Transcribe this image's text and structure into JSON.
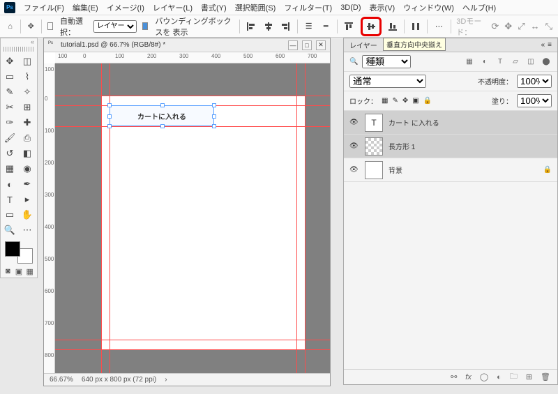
{
  "menu": {
    "file": "ファイル(F)",
    "edit": "編集(E)",
    "image": "イメージ(I)",
    "layer": "レイヤー(L)",
    "type": "書式(Y)",
    "select": "選択範囲(S)",
    "filter": "フィルター(T)",
    "3d": "3D(D)",
    "view": "表示(V)",
    "window": "ウィンドウ(W)",
    "help": "ヘルプ(H)"
  },
  "options": {
    "auto_select_label": "自動選択：",
    "auto_select_target": "レイヤー",
    "show_bbox": "バウンディングボックスを 表示",
    "mode3d": "3Dモード："
  },
  "tooltip": "垂直方向中央揃え",
  "document": {
    "title": "tutorial1.psd @ 66.7% (RGB/8#) *",
    "zoom": "66.67%",
    "dims": "640 px x 800 px (72 ppi)",
    "ruler_h": [
      "100",
      "0",
      "100",
      "200",
      "300",
      "400",
      "500",
      "600",
      "700"
    ],
    "ruler_v": [
      "100",
      "0",
      "100",
      "200",
      "300",
      "400",
      "500",
      "600",
      "700",
      "800"
    ],
    "selected_text": "カートに入れる"
  },
  "layers_panel": {
    "title": "レイヤー",
    "filter_label": "種類",
    "blend_mode": "通常",
    "opacity_label": "不透明度：",
    "opacity_value": "100%",
    "lock_label": "ロック：",
    "fill_label": "塗り：",
    "fill_value": "100%",
    "layers": [
      {
        "name": "カート に入れる",
        "type": "T",
        "active": true
      },
      {
        "name": "長方形 1",
        "type": "shape",
        "active": true
      },
      {
        "name": "背景",
        "type": "bg",
        "locked": true
      }
    ]
  }
}
